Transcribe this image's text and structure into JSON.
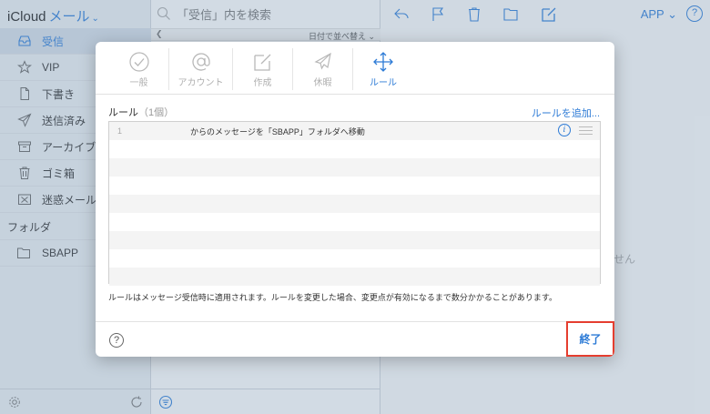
{
  "app": {
    "brand": "iCloud",
    "app_name": "メール",
    "user": "APP",
    "help_glyph": "?"
  },
  "sidebar": {
    "items": [
      {
        "label": "受信",
        "icon": "inbox-icon"
      },
      {
        "label": "VIP",
        "icon": "star-icon"
      },
      {
        "label": "下書き",
        "icon": "document-icon"
      },
      {
        "label": "送信済み",
        "icon": "paper-plane-icon"
      },
      {
        "label": "アーカイブ",
        "icon": "archive-box-icon"
      },
      {
        "label": "ゴミ箱",
        "icon": "trash-icon"
      },
      {
        "label": "迷惑メール",
        "icon": "junk-icon"
      }
    ],
    "folders_heading": "フォルダ",
    "folders": [
      {
        "label": "SBAPP",
        "icon": "folder-icon"
      }
    ]
  },
  "list": {
    "search_placeholder": "「受信」内を検索",
    "sort_label": "日付で並べ替え",
    "empty_note_fragment": "せん"
  },
  "modal": {
    "tabs": [
      {
        "label": "一般",
        "icon": "checkmark-circle-icon"
      },
      {
        "label": "アカウント",
        "icon": "at-sign-icon"
      },
      {
        "label": "作成",
        "icon": "compose-icon"
      },
      {
        "label": "休暇",
        "icon": "airplane-icon"
      },
      {
        "label": "ルール",
        "icon": "move-arrows-icon"
      }
    ],
    "active_tab": "ルール",
    "rules_title": "ルール",
    "rules_count": "（1個）",
    "add_rule": "ルールを追加...",
    "rules": [
      {
        "number": "1",
        "description": "からのメッセージを「SBAPP」フォルダへ移動"
      }
    ],
    "note": "ルールはメッセージ受信時に適用されます。ルールを変更した場合、変更点が有効になるまで数分かかることがあります。",
    "help_glyph": "?",
    "done_label": "終了"
  },
  "colors": {
    "accent": "#2d7bd6",
    "highlight_border": "#e53e2f"
  }
}
